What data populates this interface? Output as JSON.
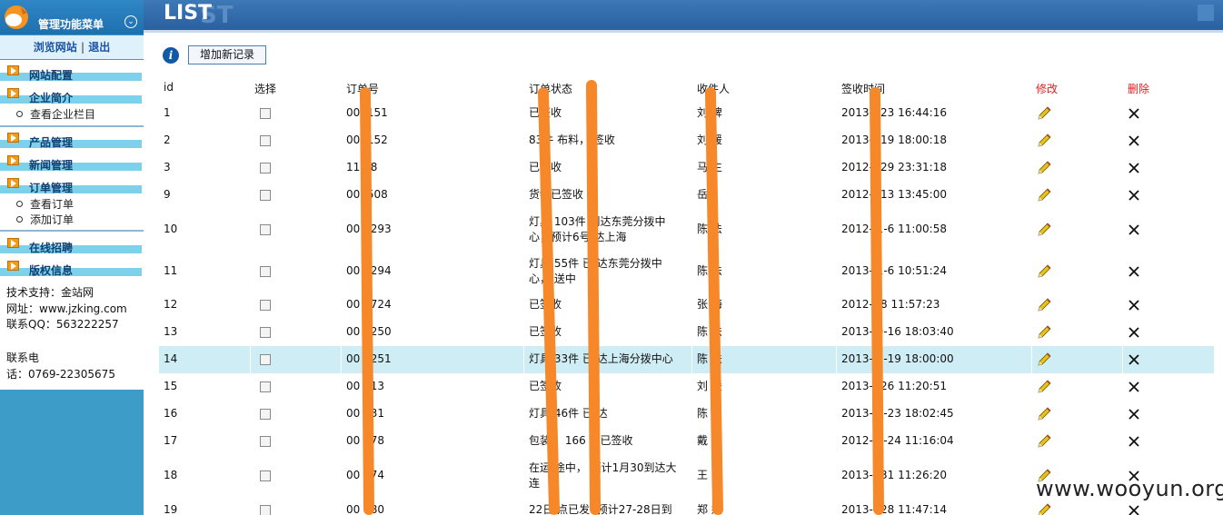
{
  "sidebar": {
    "title": "管理功能菜单",
    "toggle_icon": "double-chevron-down-icon",
    "links": {
      "browse": "浏览网站",
      "separator": "|",
      "logout": "退出"
    },
    "menus": [
      {
        "label": "网站配置",
        "subs": []
      },
      {
        "label": "企业简介",
        "subs": [
          "查看企业栏目"
        ]
      },
      {
        "label": "产品管理",
        "subs": []
      },
      {
        "label": "新闻管理",
        "subs": []
      },
      {
        "label": "订单管理",
        "subs": [
          "查看订单",
          "添加订单"
        ]
      },
      {
        "label": "在线招聘",
        "subs": []
      },
      {
        "label": "版权信息",
        "subs": []
      }
    ],
    "info": {
      "support": "技术支持：金站网",
      "site": "网址：www.jzking.com",
      "qq": "联系QQ：563222257",
      "phone_line1": "联系电",
      "phone_line2": "话：0769-22305675"
    }
  },
  "header": {
    "title": "LIST",
    "ghost": "ST"
  },
  "toolbar": {
    "add_label": "增加新记录"
  },
  "table": {
    "headers": {
      "id": "id",
      "select": "选择",
      "order_no": "订单号",
      "status": "订单状态",
      "receiver": "收件人",
      "sign_time": "签收时间",
      "edit": "修改",
      "delete": "删除"
    },
    "rows": [
      {
        "id": "1",
        "order_no": "001151",
        "status": [
          "已签收"
        ],
        "receiver": "刘 婢",
        "sign_time": "2013- -23 16:44:16"
      },
      {
        "id": "2",
        "order_no": "001152",
        "status": [
          "83件 布料， 签收"
        ],
        "receiver": "刘 媛",
        "sign_time": "2013- -19 18:00:18"
      },
      {
        "id": "3",
        "order_no": "11 48",
        "status": [
          "已签收"
        ],
        "receiver": "马 生",
        "sign_time": "2012- -29 23:31:18"
      },
      {
        "id": "9",
        "order_no": "001508",
        "status": [
          "货物已签收"
        ],
        "receiver": "岳 ",
        "sign_time": "2012- -13 13:45:00"
      },
      {
        "id": "10",
        "order_no": "00 0293",
        "status": [
          "灯具 103件 到达东莞分拨中",
          "心，预计6号 达上海"
        ],
        "receiver": "陈 法",
        "sign_time": "2012- 1-6 11:00:58"
      },
      {
        "id": "11",
        "order_no": "00 0294",
        "status": [
          "灯具 55件 已 达东莞分拨中",
          "心， 送中"
        ],
        "receiver": "陈 法",
        "sign_time": "2013- 1-6 10:51:24"
      },
      {
        "id": "12",
        "order_no": "00 1724",
        "status": [
          "已签收"
        ],
        "receiver": "张 海",
        "sign_time": "2012- -8 11:57:23"
      },
      {
        "id": "13",
        "order_no": "00 0250",
        "status": [
          "已签收"
        ],
        "receiver": "陈 法",
        "sign_time": "2013- 0-16 18:03:40"
      },
      {
        "id": "14",
        "order_no": "00 0251",
        "status": [
          "灯具 33件 已 达上海分拨中心"
        ],
        "receiver": "陈 法",
        "sign_time": "2013- 0-19 18:00:00"
      },
      {
        "id": "15",
        "order_no": "00 113",
        "status": [
          "已签收"
        ],
        "receiver": "刘 媛",
        "sign_time": "2013- -26 11:20:51"
      },
      {
        "id": "16",
        "order_no": "00 231",
        "status": [
          "灯具 46件 已 达"
        ],
        "receiver": "陈 法",
        "sign_time": "2013- 0-23 18:02:45"
      },
      {
        "id": "17",
        "order_no": "00 878",
        "status": [
          "包装 ：166 ，已签收"
        ],
        "receiver": "戴 锋",
        "sign_time": "2012- 0-24 11:16:04"
      },
      {
        "id": "18",
        "order_no": "00 174",
        "status": [
          "在运 途中， 预计1月30到达大",
          "连"
        ],
        "receiver": "王 山",
        "sign_time": "2013- -31 11:26:20"
      },
      {
        "id": "19",
        "order_no": "00 180",
        "status": [
          "22日 点已发 ,预计27-28日到"
        ],
        "receiver": "郑 妮",
        "sign_time": "2013- -28 11:47:14"
      }
    ],
    "highlighted_row": "14",
    "edit_icon": "pencil-icon",
    "delete_icon": "x-icon"
  },
  "watermark": "www.wooyun.org",
  "colors": {
    "sidebar": "#3e9cc9",
    "header": "#2f69a9",
    "highlight": "#cfedf4",
    "red_header": "#e02020",
    "overlay_stroke": "#f6882a"
  }
}
